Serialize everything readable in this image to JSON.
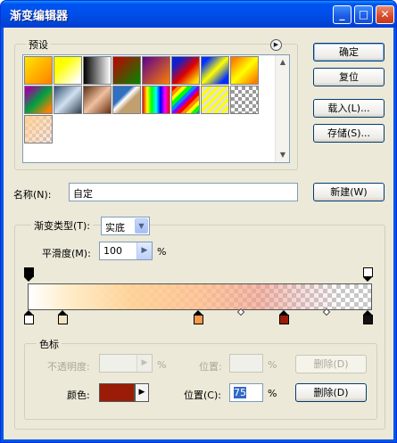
{
  "window": {
    "title": "渐变编辑器",
    "controls": {
      "minimize": "_",
      "maximize": "□",
      "close": "✕"
    }
  },
  "presets": {
    "label": "预设",
    "menu_icon": "play-icon",
    "swatches": [
      {
        "name": "yellow-orange",
        "bg": "linear-gradient(135deg,#ffe600,#ff7f00)"
      },
      {
        "name": "yellow-transparent",
        "bg": "linear-gradient(135deg,#ffff00 30%,rgba(255,255,0,0) 90%)"
      },
      {
        "name": "black-white",
        "bg": "linear-gradient(to right,#000,#fff)"
      },
      {
        "name": "red-green",
        "bg": "linear-gradient(135deg,#c40000,#008800)"
      },
      {
        "name": "violet-orange",
        "bg": "linear-gradient(135deg,#5a0090,#ff8000)"
      },
      {
        "name": "blue-red-yellow",
        "bg": "linear-gradient(135deg,#1020d0 20%,#e00000 55%,#ffe000 90%)"
      },
      {
        "name": "blue-yellow-blue",
        "bg": "linear-gradient(135deg,#0030ff 15%,#ffff00 50%,#0030ff 85%)"
      },
      {
        "name": "orange-yellow-orange",
        "bg": "linear-gradient(135deg,#ff8000 10%,#ffff00 50%,#ff8000 90%)"
      },
      {
        "name": "violet-green-orange",
        "bg": "linear-gradient(135deg,#a000a0 10%,#00a040 50%,#ff8000 90%)"
      },
      {
        "name": "steel-bar",
        "bg": "linear-gradient(135deg,#305070,#d0e0f0,#304050)"
      },
      {
        "name": "copper",
        "bg": "linear-gradient(135deg,#5a2e10,#f0c0a0,#6a3010)"
      },
      {
        "name": "chrome",
        "bg": "linear-gradient(135deg,#3070c0 35%,#ffffff 45%,#c0a070 60%)"
      },
      {
        "name": "spectrum",
        "bg": "linear-gradient(to right,#ff0000,#ffff00,#00ff00,#00ffff,#0000ff,#ff00ff,#ff0000)"
      },
      {
        "name": "transparent-rainbow",
        "bg": "repeating-linear-gradient(135deg,#ff0000 0 4px,#ff8800 4px 8px,#ffff00 8px 12px,#00ff00 12px 16px,#0088ff 16px 20px,#8800ff 20px 24px)"
      },
      {
        "name": "transparent-stripes",
        "bg": "repeating-linear-gradient(135deg,#ffff00 0 3px,#e0e0e0 3px 6px)"
      },
      {
        "name": "neutral-density",
        "bg": "repeating-conic-gradient(#9a9a9a 0% 25%,#ffffff 0% 50%) 0 0 / 8px 8px"
      },
      {
        "name": "custom",
        "bg": "linear-gradient(135deg,rgba(255,210,150,1),rgba(240,150,130,0.2)), repeating-conic-gradient(#c8c8c8 0% 25%,#ffffff 0% 50%) 0 0 / 8px 8px"
      }
    ]
  },
  "buttons": {
    "ok": "确定",
    "reset": "复位",
    "load": "载入(L)...",
    "save": "存储(S)...",
    "new": "新建(W)",
    "delete_opacity": "删除(D)",
    "delete_color": "删除(D)"
  },
  "name_row": {
    "label": "名称(N):",
    "value": "自定"
  },
  "gradient": {
    "type_label": "渐变类型(T):",
    "type_value": "实底",
    "smoothness_label": "平滑度(M):",
    "smoothness_value": "100",
    "smoothness_unit": "%",
    "color_stops": [
      {
        "name": "color-stop-1",
        "color": "#ffffff",
        "selected": false
      },
      {
        "name": "color-stop-2",
        "color": "#f3e2c0",
        "selected": false
      },
      {
        "name": "color-stop-3",
        "color": "#f39a4c",
        "selected": false
      },
      {
        "name": "color-stop-4",
        "color": "#9a1c06",
        "selected": false
      },
      {
        "name": "color-stop-5",
        "color": "#111111",
        "selected": false
      }
    ],
    "opacity_stops": [
      {
        "name": "opacity-stop-left",
        "color": "#000000"
      },
      {
        "name": "opacity-stop-right",
        "color": "#ffffff"
      }
    ]
  },
  "stops_group": {
    "label": "色标",
    "opacity_label": "不透明度:",
    "opacity_value": "",
    "opacity_unit": "%",
    "opacity_location_label": "位置:",
    "opacity_location_value": "",
    "opacity_location_unit": "%",
    "color_label": "颜色:",
    "color_swatch": "#9a1c06",
    "location_label": "位置(C):",
    "location_value": "75",
    "location_unit": "%"
  }
}
